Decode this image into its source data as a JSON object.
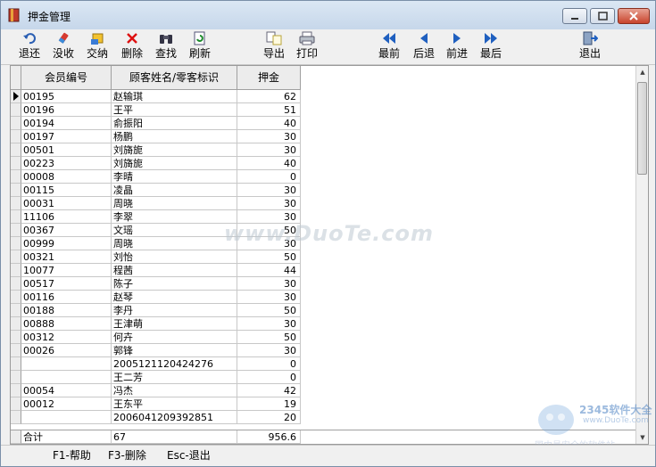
{
  "window": {
    "title": "押金管理"
  },
  "toolbar": {
    "buttons": [
      {
        "label": "退还",
        "icon": "return-arrow-icon"
      },
      {
        "label": "没收",
        "icon": "confiscate-icon"
      },
      {
        "label": "交纳",
        "icon": "deposit-icon"
      },
      {
        "label": "删除",
        "icon": "delete-x-icon"
      },
      {
        "label": "查找",
        "icon": "binoculars-icon"
      },
      {
        "label": "刷新",
        "icon": "refresh-icon"
      },
      {
        "label": "导出",
        "icon": "export-icon"
      },
      {
        "label": "打印",
        "icon": "printer-icon"
      },
      {
        "label": "最前",
        "icon": "first-record-icon"
      },
      {
        "label": "后退",
        "icon": "previous-record-icon"
      },
      {
        "label": "前进",
        "icon": "next-record-icon"
      },
      {
        "label": "最后",
        "icon": "last-record-icon"
      },
      {
        "label": "退出",
        "icon": "exit-door-icon"
      }
    ]
  },
  "table": {
    "columns": [
      "会员编号",
      "顾客姓名/零客标识",
      "押金"
    ],
    "rows": [
      [
        "00195",
        "赵输琪",
        "62"
      ],
      [
        "00196",
        "王平",
        "51"
      ],
      [
        "00194",
        "俞振阳",
        "40"
      ],
      [
        "00197",
        "杨鹏",
        "30"
      ],
      [
        "00501",
        "刘旖旎",
        "30"
      ],
      [
        "00223",
        "刘旖旎",
        "40"
      ],
      [
        "00008",
        "李晴",
        "0"
      ],
      [
        "00115",
        "凌晶",
        "30"
      ],
      [
        "00031",
        "周晓",
        "30"
      ],
      [
        "11106",
        "李翠",
        "30"
      ],
      [
        "00367",
        "文瑶",
        "50"
      ],
      [
        "00999",
        "周晓",
        "30"
      ],
      [
        "00321",
        "刘怡",
        "50"
      ],
      [
        "10077",
        "程茜",
        "44"
      ],
      [
        "00517",
        "陈子",
        "30"
      ],
      [
        "00116",
        "赵琴",
        "30"
      ],
      [
        "00188",
        "李丹",
        "50"
      ],
      [
        "00888",
        "王津萌",
        "30"
      ],
      [
        "00312",
        "何卉",
        "50"
      ],
      [
        "00026",
        "郭锋",
        "30"
      ],
      [
        "",
        "2005121120424276",
        "0"
      ],
      [
        "",
        "王二芳",
        "0"
      ],
      [
        "00054",
        "冯杰",
        "42"
      ],
      [
        "00012",
        "王东平",
        "19"
      ],
      [
        "",
        "2006041209392851",
        "20"
      ]
    ],
    "totals": {
      "label": "合计",
      "count": "67",
      "amount": "956.6"
    }
  },
  "statusbar": {
    "hints": [
      "F1-帮助",
      "F3-删除",
      "Esc-退出"
    ]
  },
  "watermark": {
    "text": "www.DuoTe.com"
  },
  "corner_logo": {
    "brand": "2345软件大全",
    "url": "www.DuoTe.com",
    "slogan": "国内最安全的软件站"
  },
  "colors": {
    "accent": "#1f5fbf",
    "header_bg": "#ececec",
    "grid_line": "#c8c8c8"
  }
}
